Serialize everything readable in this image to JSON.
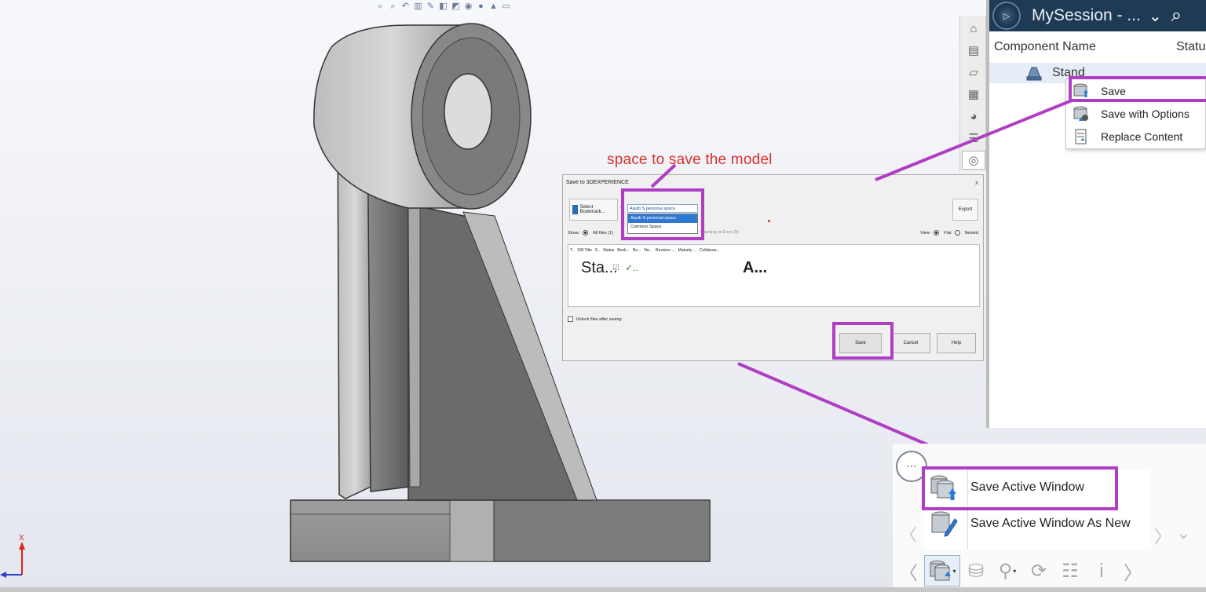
{
  "session": {
    "title": "MySession - ...",
    "chevron": "⌄",
    "search_icon": "⌕",
    "col_name": "Component Name",
    "col_status": "Statu",
    "row_label": "Stand",
    "menu": [
      "Save",
      "Save with Options",
      "Replace Content"
    ]
  },
  "dialog": {
    "title": "Save to 3DEXPERIENCE",
    "close": "x",
    "bookmark": "Select Bookmark...",
    "bookmark_arrow": "▾",
    "space_selected": "Aquib S personal space",
    "space_options": [
      "Aquib S personal space",
      "Common Space"
    ],
    "export": "Export",
    "show_label": "Show:",
    "show_all": "All files (1)",
    "warn_filter": "Warning or Error (0)",
    "view_label": "View:",
    "view_flat": "Flat",
    "view_nested": "Nested",
    "columns": [
      "T..",
      "SW Title",
      "S..",
      "Status",
      "Book...",
      "Re...",
      "Ne...",
      "Revision ...",
      "Maturity ...",
      "Collabora..."
    ],
    "row": {
      "title": "Sta...",
      "status": "✓..",
      "collab": "A..."
    },
    "unlock": "Unlock files after saving",
    "save": "Save",
    "cancel": "Cancel",
    "help": "Help"
  },
  "annotation": {
    "text": "space to save the model",
    "color": "#d9302a",
    "highlight": "#b03ec4"
  },
  "flyout": [
    "Save Active Window",
    "Save Active Window As New"
  ],
  "nav_glyphs": {
    "left": "〈",
    "right": "〉",
    "down": "⌄",
    "dropdown": "▾"
  },
  "triad": {
    "axis": "X"
  },
  "colors": {
    "header": "#1f3a54",
    "selection": "#e5eef7",
    "model": "#8f8f8f"
  }
}
